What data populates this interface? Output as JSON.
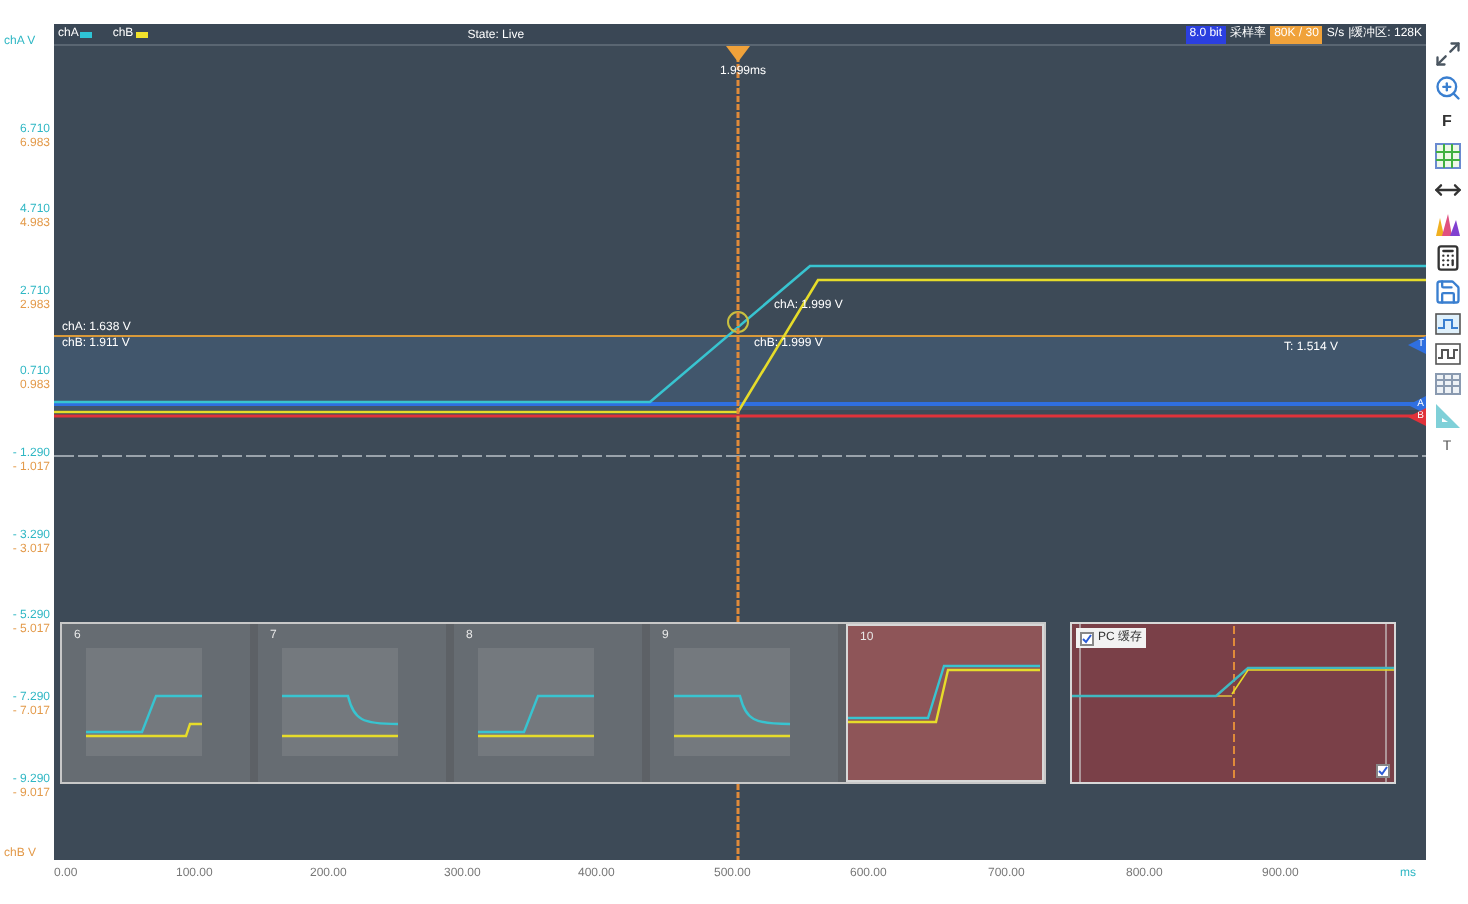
{
  "header": {
    "channels": [
      {
        "label": "chA",
        "color": "#2ec4d6"
      },
      {
        "label": "chB",
        "color": "#f2e22c"
      }
    ],
    "state": "State: Live",
    "bits": "8.0 bit",
    "rate_label": "采样率",
    "rate": "80K / 30",
    "rate_unit": "S/s",
    "buffer": "|缓冲区: 128K"
  },
  "y_axis": {
    "cha_unit": "chA V",
    "chb_unit": "chB V",
    "ticks": [
      {
        "a": "6.710",
        "b": "6.983"
      },
      {
        "a": "4.710",
        "b": "4.983"
      },
      {
        "a": "2.710",
        "b": "2.983"
      },
      {
        "a": "0.710",
        "b": "0.983"
      },
      {
        "a": "- 1.290",
        "b": "- 1.017"
      },
      {
        "a": "- 3.290",
        "b": "- 3.017"
      },
      {
        "a": "- 5.290",
        "b": "- 5.017"
      },
      {
        "a": "- 7.290",
        "b": "- 7.017"
      },
      {
        "a": "- 9.290",
        "b": "- 9.017"
      }
    ]
  },
  "x_axis": {
    "labels": [
      "0.00",
      "100.00",
      "200.00",
      "300.00",
      "400.00",
      "500.00",
      "600.00",
      "700.00",
      "800.00",
      "900.00"
    ],
    "unit": "ms"
  },
  "cursor": {
    "time": "1.999ms",
    "cha": "chA: 1.999 V",
    "chb": "chB: 1.999 V"
  },
  "level_readout": {
    "cha": "chA: 1.638 V",
    "chb": "chB: 1.911 V"
  },
  "trigger": {
    "reading": "T: 1.514 V"
  },
  "markers": [
    {
      "label": "T",
      "color": "#2f6fe0"
    },
    {
      "label": "A",
      "color": "#2f6fe0"
    },
    {
      "label": "B",
      "color": "#e0323a"
    }
  ],
  "thumbnails": [
    {
      "label": "6",
      "kind": "rise_late",
      "selected": false
    },
    {
      "label": "7",
      "kind": "fall",
      "selected": false
    },
    {
      "label": "8",
      "kind": "rise",
      "selected": false
    },
    {
      "label": "9",
      "kind": "fall",
      "selected": false
    },
    {
      "label": "10",
      "kind": "rise_big",
      "selected": true
    }
  ],
  "pc_cache": {
    "label": "PC 缓存",
    "checked": true,
    "corner_checked": true
  },
  "toolbar": {
    "f_label": "F",
    "t_label": "T"
  }
}
